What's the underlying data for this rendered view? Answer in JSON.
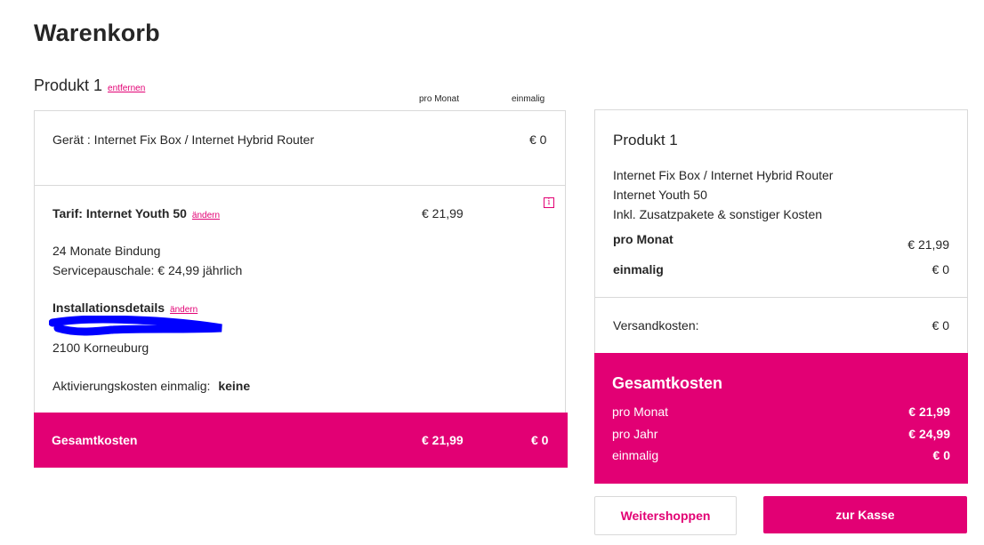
{
  "page": {
    "title": "Warenkorb"
  },
  "product": {
    "heading": "Produkt 1",
    "remove_link": "entfernen",
    "col_monthly": "pro Monat",
    "col_once": "einmalig",
    "device": {
      "label": "Gerät : Internet Fix Box / Internet Hybrid Router",
      "price_once": "€ 0"
    },
    "tariff": {
      "label": "Tarif: Internet Youth 50",
      "change_link": "ändern",
      "price_monthly": "€ 21,99",
      "info_icon": "info-icon",
      "info_glyph": "i",
      "binding": "24 Monate Bindung",
      "service_fee": "Servicepauschale: € 24,99 jährlich"
    },
    "installation": {
      "label": "Installationsdetails",
      "change_link": "ändern",
      "city": "2100 Korneuburg",
      "activation_label": "Aktivierungskosten einmalig:",
      "activation_value": "keine"
    },
    "total": {
      "label": "Gesamtkosten",
      "monthly": "€ 21,99",
      "once": "€ 0"
    }
  },
  "summary": {
    "heading": "Produkt 1",
    "lines": [
      "Internet Fix Box / Internet Hybrid Router",
      "Internet Youth 50",
      "Inkl. Zusatzpakete & sonstiger Kosten"
    ],
    "monthly_label": "pro Monat",
    "monthly_value": "€ 21,99",
    "once_label": "einmalig",
    "once_value": "€ 0",
    "shipping_label": "Versandkosten:",
    "shipping_value": "€ 0",
    "total": {
      "title": "Gesamtkosten",
      "rows": [
        {
          "label": "pro Monat",
          "value": "€ 21,99"
        },
        {
          "label": "pro Jahr",
          "value": "€ 24,99"
        },
        {
          "label": "einmalig",
          "value": "€ 0"
        }
      ]
    }
  },
  "actions": {
    "continue_shopping": "Weitershoppen",
    "checkout": "zur Kasse"
  },
  "colors": {
    "accent": "#e20074",
    "border": "#d9d9d9",
    "text": "#262626",
    "redaction": "#0000ff"
  }
}
